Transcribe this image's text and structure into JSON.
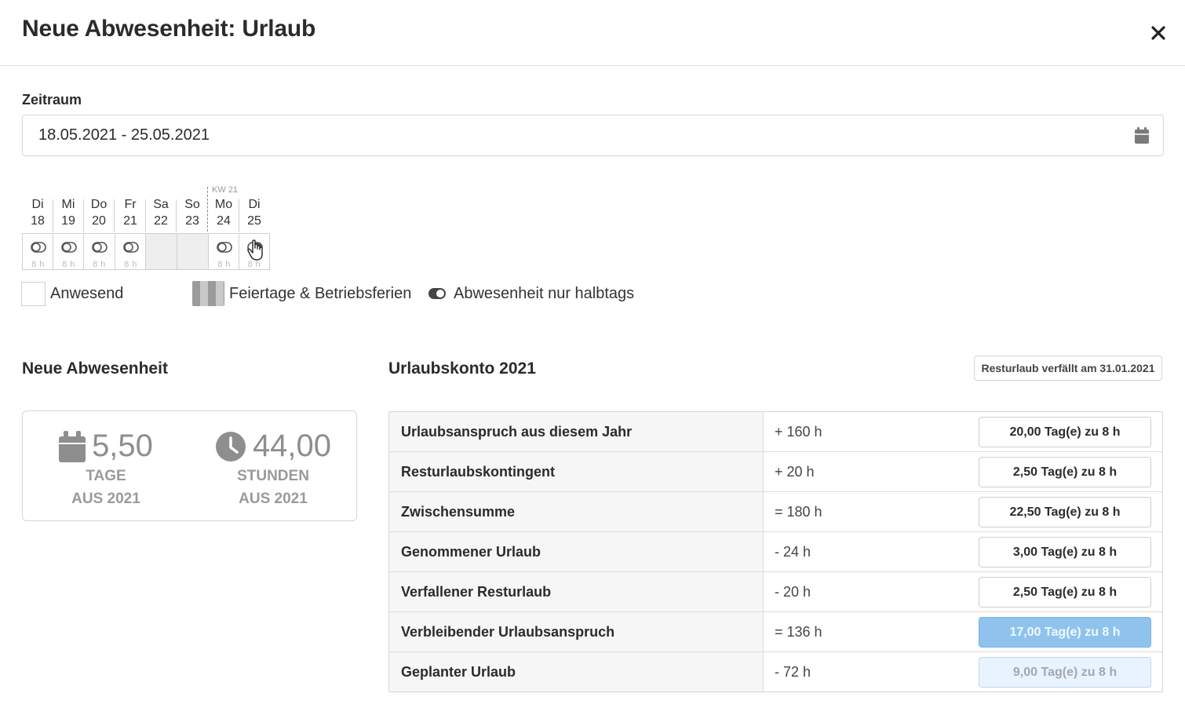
{
  "dialog": {
    "title": "Neue Abwesenheit: Urlaub",
    "close_label": "×"
  },
  "zeitraum": {
    "label": "Zeitraum",
    "value": "18.05.2021 - 25.05.2021",
    "calendar_icon": "calendar-icon"
  },
  "calendar": {
    "week_label": "KW 21",
    "days": [
      {
        "name": "Di",
        "num": "18",
        "hours": "8 h",
        "weekend": false
      },
      {
        "name": "Mi",
        "num": "19",
        "hours": "8 h",
        "weekend": false
      },
      {
        "name": "Do",
        "num": "20",
        "hours": "8 h",
        "weekend": false
      },
      {
        "name": "Fr",
        "num": "21",
        "hours": "8 h",
        "weekend": false
      },
      {
        "name": "Sa",
        "num": "22",
        "hours": "",
        "weekend": true
      },
      {
        "name": "So",
        "num": "23",
        "hours": "",
        "weekend": true
      },
      {
        "name": "Mo",
        "num": "24",
        "hours": "8 h",
        "weekend": false
      },
      {
        "name": "Di",
        "num": "25",
        "hours": "8 h",
        "weekend": false
      }
    ]
  },
  "legend": {
    "present": "Anwesend",
    "holidays": "Feiertage & Betriebsferien",
    "halfday": "Abwesenheit nur halbtags"
  },
  "new_absence": {
    "title": "Neue Abwesenheit",
    "days_value": "5,50",
    "days_caption_1": "TAGE",
    "days_caption_2": "AUS 2021",
    "hours_value": "44,00",
    "hours_caption_1": "STUNDEN",
    "hours_caption_2": "AUS 2021"
  },
  "account": {
    "title": "Urlaubskonto 2021",
    "note": "Resturlaub verfällt am 31.01.2021",
    "rows": [
      {
        "label": "Urlaubsanspruch aus diesem Jahr",
        "hours": "+ 160 h",
        "days": "20,00 Tag(e) zu 8 h"
      },
      {
        "label": "Resturlaubskontingent",
        "hours": "+ 20 h",
        "days": "2,50 Tag(e) zu 8 h"
      },
      {
        "label": "Zwischensumme",
        "hours": "= 180 h",
        "days": "22,50 Tag(e) zu 8 h"
      },
      {
        "label": "Genommener Urlaub",
        "hours": "- 24 h",
        "days": "3,00 Tag(e) zu 8 h"
      },
      {
        "label": "Verfallener Resturlaub",
        "hours": "- 20 h",
        "days": "2,50 Tag(e) zu 8 h"
      },
      {
        "label": "Verbleibender Urlaubsanspruch",
        "hours": "= 136 h",
        "days": "17,00 Tag(e) zu 8 h"
      },
      {
        "label": "Geplanter Urlaub",
        "hours": "- 72 h",
        "days": "9,00 Tag(e) zu 8 h"
      }
    ]
  },
  "colors": {
    "highlight_blue": "#8fc3ee",
    "planned_blue": "#e8f3fd"
  }
}
